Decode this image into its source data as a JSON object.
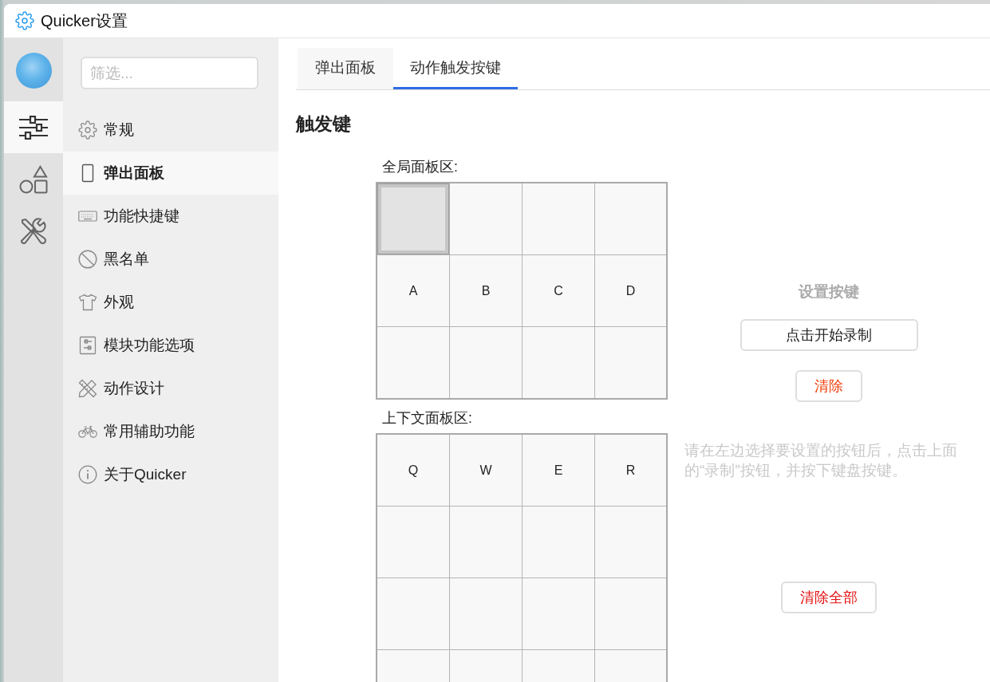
{
  "window": {
    "title": "Quicker设置"
  },
  "rail": {
    "items": [
      {
        "selected": true
      },
      {
        "selected": false
      },
      {
        "selected": false
      }
    ]
  },
  "nav": {
    "filter": {
      "placeholder": "筛选..."
    },
    "items": [
      {
        "label": "常规",
        "selected": false
      },
      {
        "label": "弹出面板",
        "selected": true
      },
      {
        "label": "功能快捷键",
        "selected": false
      },
      {
        "label": "黑名单",
        "selected": false
      },
      {
        "label": "外观",
        "selected": false
      },
      {
        "label": "模块功能选项",
        "selected": false
      },
      {
        "label": "动作设计",
        "selected": false
      },
      {
        "label": "常用辅助功能",
        "selected": false
      },
      {
        "label": "关于Quicker",
        "selected": false
      }
    ]
  },
  "tabs": [
    {
      "label": "弹出面板",
      "selected": false
    },
    {
      "label": "动作触发按键",
      "selected": true
    }
  ],
  "section_title": "触发键",
  "panels": [
    {
      "label": "全局面板区:",
      "rows": [
        [
          {
            "selected": true
          },
          {
            "selected": false
          },
          {
            "selected": false
          },
          {
            "selected": false
          }
        ],
        [
          {
            "key": "A",
            "selected": false
          },
          {
            "key": "B",
            "selected": false
          },
          {
            "key": "C",
            "selected": false
          },
          {
            "key": "D",
            "selected": false
          }
        ],
        [
          {
            "selected": false
          },
          {
            "selected": false
          },
          {
            "selected": false
          },
          {
            "selected": false
          }
        ]
      ]
    },
    {
      "label": "上下文面板区:",
      "rows": [
        [
          {
            "key": "Q",
            "selected": false
          },
          {
            "key": "W",
            "selected": false
          },
          {
            "key": "E",
            "selected": false
          },
          {
            "key": "R",
            "selected": false
          }
        ],
        [
          {
            "selected": false
          },
          {
            "selected": false
          },
          {
            "selected": false
          },
          {
            "selected": false
          }
        ],
        [
          {
            "selected": false
          },
          {
            "selected": false
          },
          {
            "selected": false
          },
          {
            "selected": false
          }
        ],
        [
          {
            "selected": false
          },
          {
            "selected": false
          },
          {
            "selected": false
          },
          {
            "selected": false
          }
        ]
      ]
    }
  ],
  "key_setting": {
    "title": "设置按键",
    "record_button": "点击开始录制",
    "clear_button": "清除",
    "hint": "请在左边选择要设置的按钮后，点击上面的“录制”按钮，并按下键盘按键。",
    "clear_all_button": "清除全部"
  }
}
